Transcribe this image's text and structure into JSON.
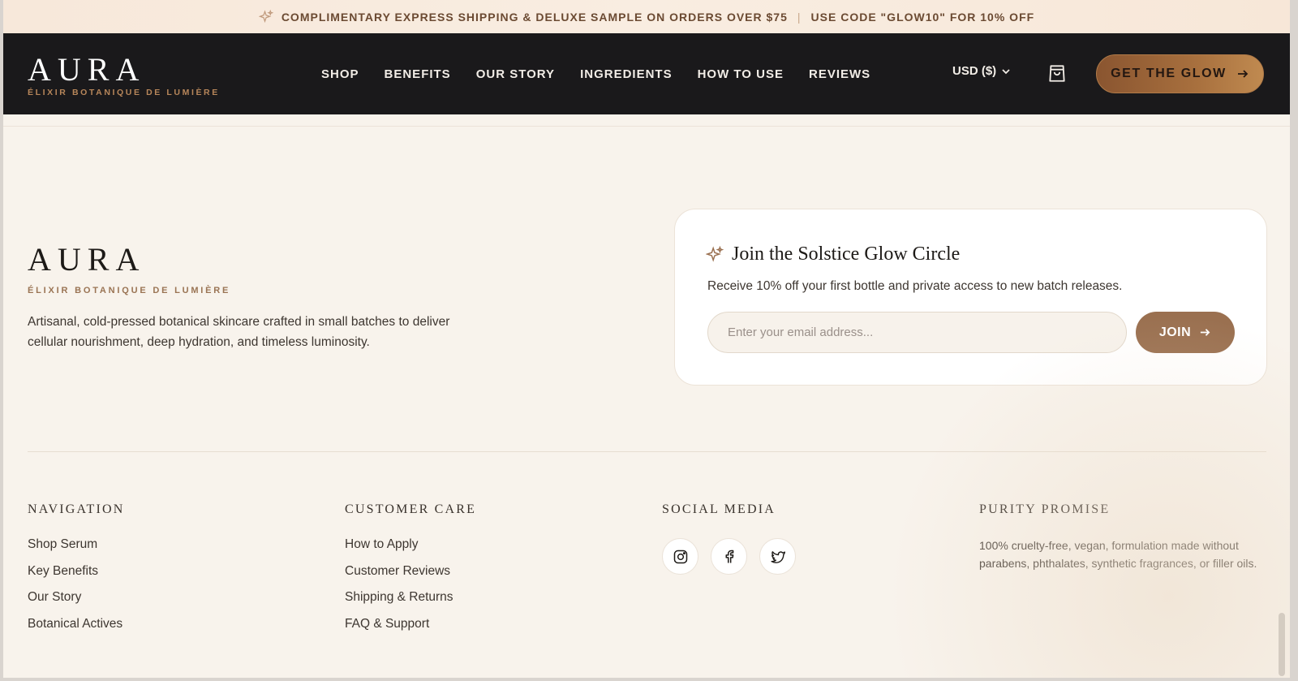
{
  "announcement": {
    "left": "COMPLIMENTARY EXPRESS SHIPPING & DELUXE SAMPLE ON ORDERS OVER $75",
    "separator": "|",
    "right": "USE CODE \"GLOW10\" FOR 10% OFF"
  },
  "header": {
    "logo": "AURA",
    "tagline": "ÉLIXIR BOTANIQUE DE LUMIÈRE",
    "nav": [
      "SHOP",
      "BENEFITS",
      "OUR STORY",
      "INGREDIENTS",
      "HOW TO USE",
      "REVIEWS"
    ],
    "currency": "USD ($)",
    "cta": "GET THE GLOW"
  },
  "brand": {
    "logo": "AURA",
    "tagline": "ÉLIXIR BOTANIQUE DE LUMIÈRE",
    "description": "Artisanal, cold-pressed botanical skincare crafted in small batches to deliver cellular nourishment, deep hydration, and timeless luminosity."
  },
  "newsletter": {
    "title": "Join the Solstice Glow Circle",
    "text": "Receive 10% off your first bottle and private access to new batch releases.",
    "placeholder": "Enter your email address...",
    "button": "JOIN"
  },
  "footer": {
    "navigation": {
      "heading": "NAVIGATION",
      "links": [
        "Shop Serum",
        "Key Benefits",
        "Our Story",
        "Botanical Actives"
      ]
    },
    "customer_care": {
      "heading": "CUSTOMER CARE",
      "links": [
        "How to Apply",
        "Customer Reviews",
        "Shipping & Returns",
        "FAQ & Support"
      ]
    },
    "social": {
      "heading": "SOCIAL MEDIA",
      "icons": [
        "instagram-icon",
        "facebook-icon",
        "twitter-icon"
      ]
    },
    "purity": {
      "heading": "PURITY PROMISE",
      "text": "100% cruelty-free, vegan, formulation made without parabens, phthalates, synthetic fragrances, or filler oils."
    }
  },
  "colors": {
    "accent": "#9a7050",
    "header_bg": "#1a191b",
    "page_bg": "#f8f3ec"
  }
}
